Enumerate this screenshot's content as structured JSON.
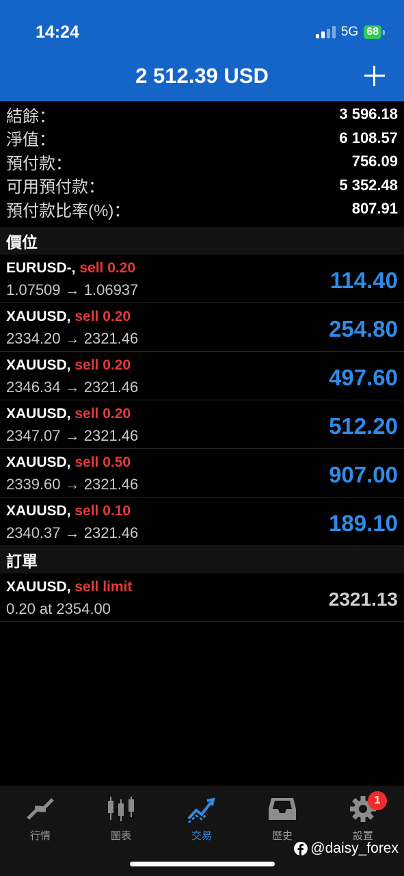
{
  "status": {
    "time": "14:24",
    "network": "5G",
    "battery": "68"
  },
  "header": {
    "balance_title": "2 512.39 USD"
  },
  "summary": [
    {
      "label": "結餘：",
      "value": "3 596.18"
    },
    {
      "label": "淨值：",
      "value": "6 108.57"
    },
    {
      "label": "預付款：",
      "value": "756.09"
    },
    {
      "label": "可用預付款：",
      "value": "5 352.48"
    },
    {
      "label": "預付款比率(%)：",
      "value": "807.91"
    }
  ],
  "positions_header": "價位",
  "positions": [
    {
      "symbol": "EURUSD-,",
      "side": "sell 0.20",
      "prices": "1.07509 → 1.06937",
      "profit": "114.40"
    },
    {
      "symbol": "XAUUSD,",
      "side": "sell 0.20",
      "prices": "2334.20 → 2321.46",
      "profit": "254.80"
    },
    {
      "symbol": "XAUUSD,",
      "side": "sell 0.20",
      "prices": "2346.34 → 2321.46",
      "profit": "497.60"
    },
    {
      "symbol": "XAUUSD,",
      "side": "sell 0.20",
      "prices": "2347.07 → 2321.46",
      "profit": "512.20"
    },
    {
      "symbol": "XAUUSD,",
      "side": "sell 0.50",
      "prices": "2339.60 → 2321.46",
      "profit": "907.00"
    },
    {
      "symbol": "XAUUSD,",
      "side": "sell 0.10",
      "prices": "2340.37 → 2321.46",
      "profit": "189.10"
    }
  ],
  "orders_header": "訂單",
  "orders": [
    {
      "symbol": "XAUUSD,",
      "side": "sell limit",
      "detail": "0.20 at 2354.00",
      "price": "2321.13"
    }
  ],
  "tabs": [
    {
      "label": "行情",
      "icon": "quotes-arrows-icon"
    },
    {
      "label": "圖表",
      "icon": "candlestick-chart-icon"
    },
    {
      "label": "交易",
      "icon": "trade-trend-icon",
      "active": true
    },
    {
      "label": "歷史",
      "icon": "history-inbox-icon"
    },
    {
      "label": "設置",
      "icon": "settings-gear-icon",
      "badge": "1"
    }
  ],
  "watermark": "@daisy_forex",
  "colors": {
    "header_blue": "#1565c9",
    "profit_blue": "#2e8ce8",
    "sell_red": "#e53935",
    "badge_red": "#ef2c2c"
  }
}
